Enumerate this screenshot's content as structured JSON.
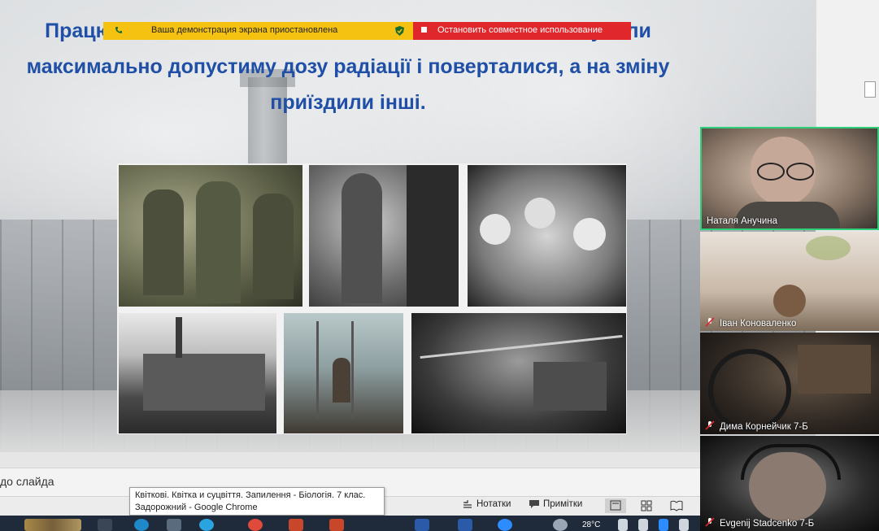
{
  "banners": {
    "paused": "Ваша демонстрация экрана приостановлена",
    "stop_sharing": "Остановить совместное использование",
    "colors": {
      "paused_bg": "#f5c211",
      "stop_bg": "#e0272c"
    }
  },
  "slide": {
    "line1": "Працю                                                                                  мували",
    "line2": "максимально допустиму дозу радіації і поверталися, а на зміну",
    "line3": "приїздили інші.",
    "text_color": "#1f4fa6"
  },
  "participants": [
    {
      "name": "Наталя Анучина",
      "muted": false,
      "active_speaker": true
    },
    {
      "name": "Іван Коноваленко",
      "muted": true
    },
    {
      "name": "Дима Корнейчик 7-Б",
      "muted": true
    },
    {
      "name": "Evgenij Stadcenko 7-Б",
      "muted": true
    }
  ],
  "notes": {
    "placeholder": "до слайда"
  },
  "statusbar": {
    "notes_label": "Нотатки",
    "comments_label": "Примітки"
  },
  "tooltip": {
    "line1": "Квіткові. Квітка и суцвіття. Запилення - Біологія. 7 клас.",
    "line2": "Задорожний - Google Chrome"
  },
  "taskbar": {
    "temperature": "28°C"
  },
  "icons": [
    "phone-icon",
    "shield-icon",
    "stop-square-icon",
    "mic-off-icon",
    "notes-icon",
    "comment-icon",
    "normal-view-icon",
    "slide-sorter-icon",
    "reading-view-icon"
  ]
}
